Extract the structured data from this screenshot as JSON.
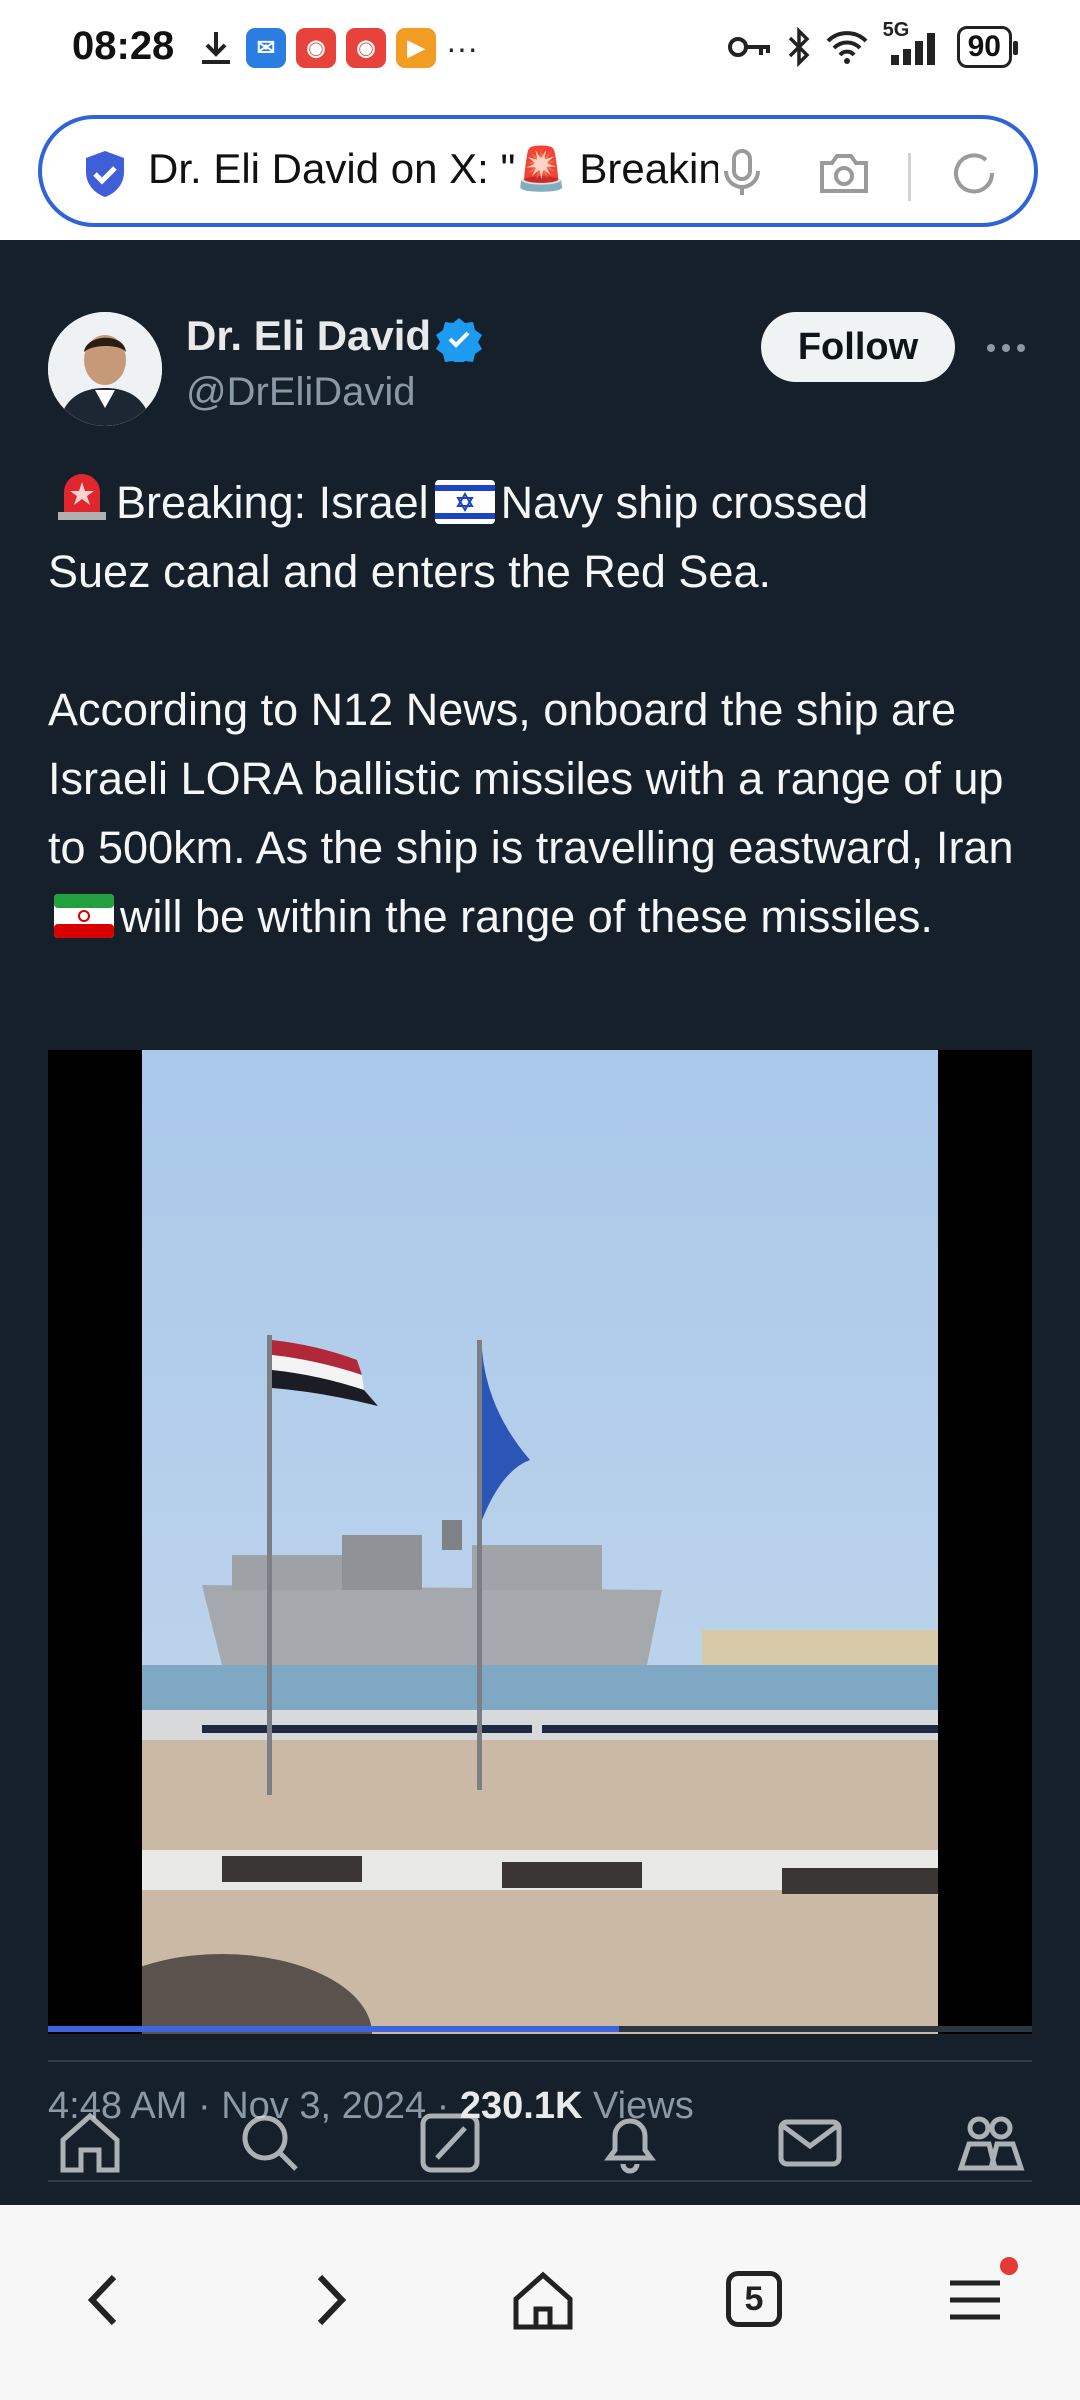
{
  "status_bar": {
    "time": "08:28",
    "network": "5G",
    "battery": "90",
    "more": "···"
  },
  "url_bar": {
    "text": "Dr. Eli David on X: \"🚨 Breaking: Israel 🇮🇱 Navy ship crossed Suez canal"
  },
  "tweet": {
    "author_name": "Dr. Eli David",
    "author_handle": "@DrEliDavid",
    "follow_label": "Follow",
    "text_breaking": "Breaking: Israel",
    "text_navy": "Navy ship crossed",
    "text_line2": "Suez canal and enters the Red Sea.",
    "text_p2_a": "According to N12 News, onboard the ship are Israeli LORA ballistic missiles with a range of up to 500km. As the ship is travelling eastward, Iran",
    "text_p2_b": "will be within the range of these missiles.",
    "time": "4:48 AM",
    "date": "Nov 3, 2024",
    "views_count": "230.1K",
    "views_label": "Views",
    "video_progress": 0.58
  },
  "app_nav": [
    "home-icon",
    "search-icon",
    "grok-icon",
    "notifications-icon",
    "messages-icon",
    "communities-icon"
  ],
  "browser_bar": {
    "tab_count": "5"
  },
  "colors": {
    "background": "#15202b",
    "accent": "#1d9bf0",
    "url_border": "#2f63d8",
    "progress": "#3d63dd"
  }
}
